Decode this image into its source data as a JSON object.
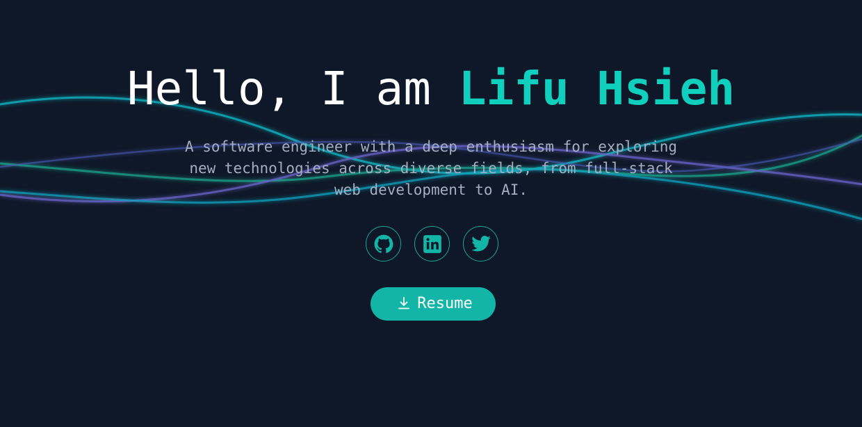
{
  "hero": {
    "greeting": "Hello, I am ",
    "name": "Lifu Hsieh",
    "tagline": "A software engineer with a deep enthusiasm for exploring new technologies across diverse fields, from full-stack web development to AI."
  },
  "socials": [
    {
      "icon": "github-icon"
    },
    {
      "icon": "linkedin-icon"
    },
    {
      "icon": "twitter-icon"
    }
  ],
  "resume": {
    "label": "Resume",
    "icon": "download-icon"
  },
  "colors": {
    "background": "#0f1828",
    "accent": "#11cfbd",
    "button": "#12b5a6",
    "muted_text": "#a4aec0"
  }
}
